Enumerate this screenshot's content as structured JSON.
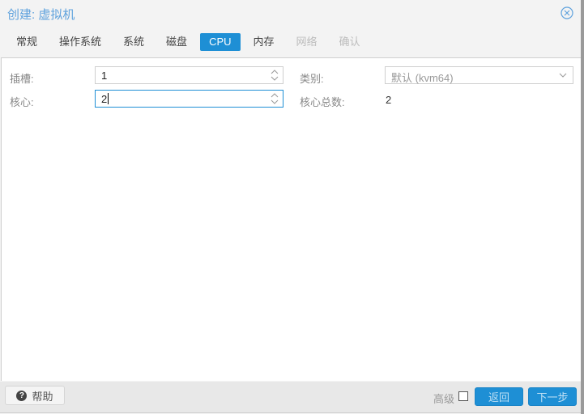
{
  "window": {
    "title": "创建: 虚拟机",
    "close_icon": "close-circle-icon"
  },
  "tabs": [
    {
      "label": "常规",
      "state": "normal"
    },
    {
      "label": "操作系统",
      "state": "normal"
    },
    {
      "label": "系统",
      "state": "normal"
    },
    {
      "label": "磁盘",
      "state": "normal"
    },
    {
      "label": "CPU",
      "state": "active"
    },
    {
      "label": "内存",
      "state": "normal"
    },
    {
      "label": "网络",
      "state": "disabled"
    },
    {
      "label": "确认",
      "state": "disabled"
    }
  ],
  "form": {
    "sockets": {
      "label": "插槽:",
      "value": "1"
    },
    "cores": {
      "label": "核心:",
      "value": "2"
    },
    "type": {
      "label": "类别:",
      "value": "默认 (kvm64)"
    },
    "total_cores": {
      "label": "核心总数:",
      "value": "2"
    }
  },
  "footer": {
    "help_label": "帮助",
    "advanced_label": "高级",
    "advanced_checked": false,
    "back_label": "返回",
    "next_label": "下一步"
  },
  "colors": {
    "accent": "#1e8fd5",
    "title": "#5fa2dd"
  }
}
